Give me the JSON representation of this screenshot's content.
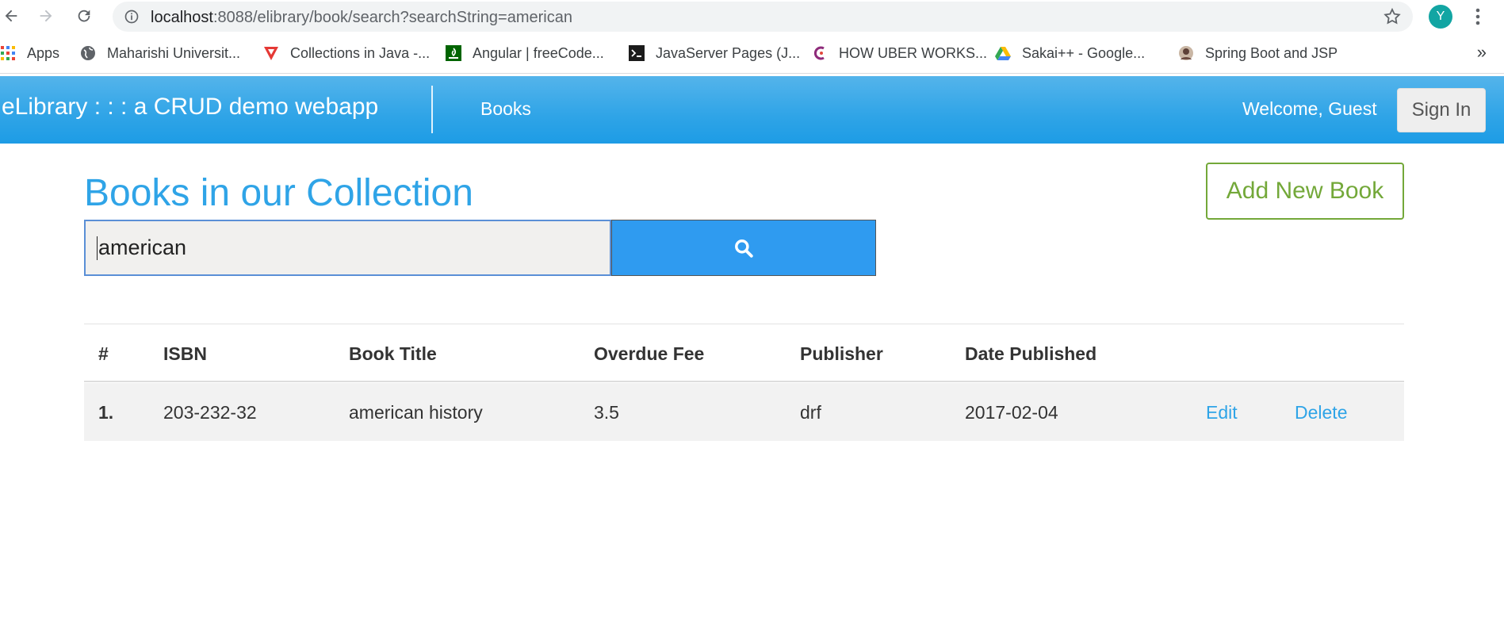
{
  "browser": {
    "url_host": "localhost",
    "url_rest": ":8088/elibrary/book/search?searchString=american",
    "profile_initial": "Y",
    "bookmarks": [
      {
        "label": "Apps",
        "icon": "apps-grid-icon"
      },
      {
        "label": "Maharishi Universit...",
        "icon": "globe-icon"
      },
      {
        "label": "Collections in Java -...",
        "icon": "red-triangle-icon"
      },
      {
        "label": "Angular | freeCode...",
        "icon": "freecodecamp-icon"
      },
      {
        "label": "JavaServer Pages (J...",
        "icon": "terminal-icon"
      },
      {
        "label": "HOW UBER WORKS...",
        "icon": "uber-logo-icon"
      },
      {
        "label": "Sakai++ - Google...",
        "icon": "google-drive-icon"
      },
      {
        "label": "Spring Boot and JSP",
        "icon": "avatar-bookmark-icon"
      }
    ],
    "more_label": "»"
  },
  "navbar": {
    "brand": "eLibrary : : : a CRUD demo webapp",
    "books_link": "Books",
    "welcome": "Welcome, Guest",
    "signin_label": "Sign In",
    "color": "#2fa4e7"
  },
  "main": {
    "title": "Books in our Collection",
    "add_button": "Add New Book",
    "search_value": "american",
    "table": {
      "headers": [
        "#",
        "ISBN",
        "Book Title",
        "Overdue Fee",
        "Publisher",
        "Date Published"
      ],
      "rows": [
        {
          "num": "1.",
          "isbn": "203-232-32",
          "title": "american history",
          "fee": "3.5",
          "publisher": "drf",
          "date": "2017-02-04",
          "edit": "Edit",
          "delete": "Delete"
        }
      ]
    }
  },
  "colors": {
    "accent": "#2fa4e7",
    "success": "#73a839",
    "search_button": "#2f9bf0"
  }
}
